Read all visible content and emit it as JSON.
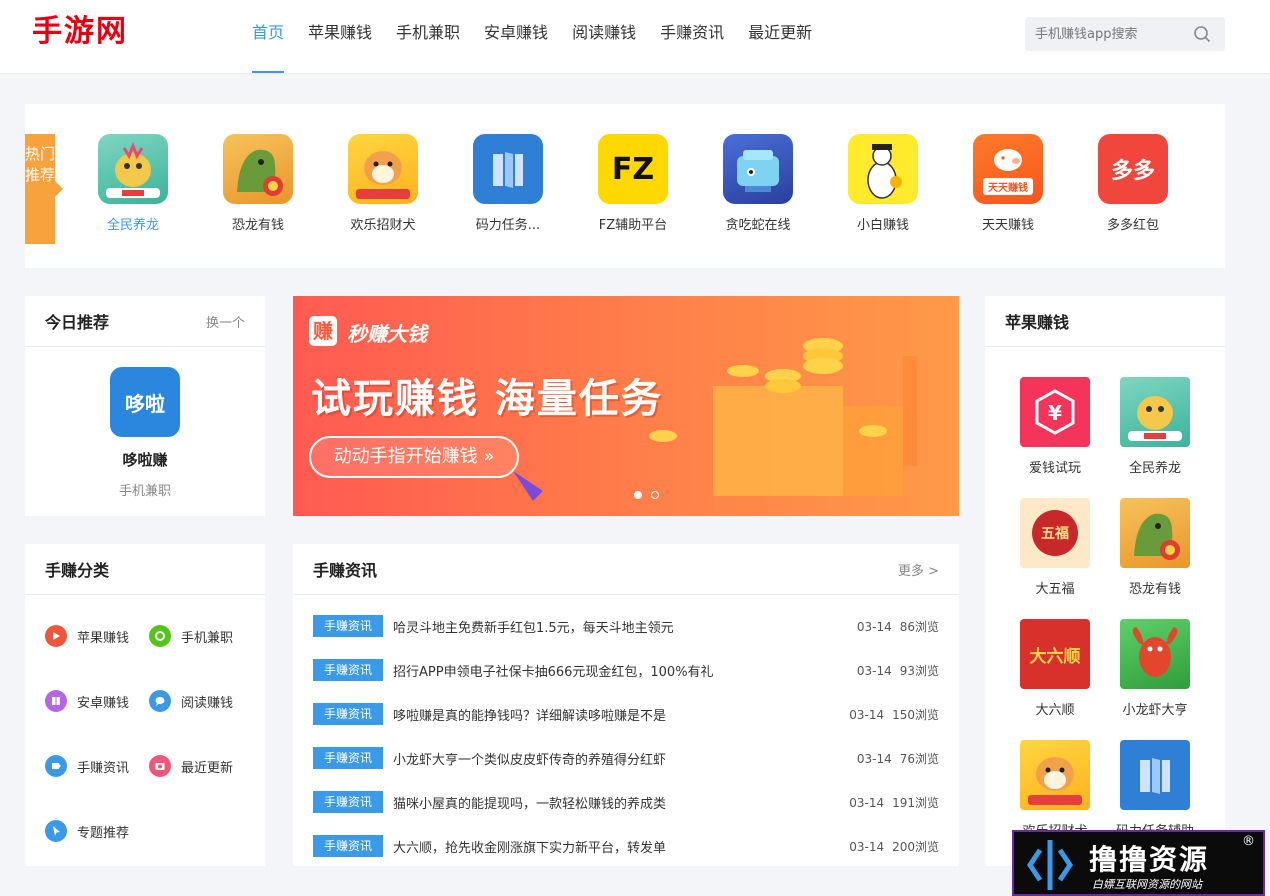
{
  "header": {
    "logo": "手游网",
    "nav": [
      "首页",
      "苹果赚钱",
      "手机兼职",
      "安卓赚钱",
      "阅读赚钱",
      "手赚资讯",
      "最近更新"
    ],
    "search_placeholder": "手机赚钱app搜索"
  },
  "hot": {
    "tag": "热门推荐",
    "items": [
      {
        "name": "全民养龙",
        "icon": "dragon-icon"
      },
      {
        "name": "恐龙有钱",
        "icon": "dinosaur-icon"
      },
      {
        "name": "欢乐招财犬",
        "icon": "dog-icon"
      },
      {
        "name": "码力任务...",
        "icon": "book-icon"
      },
      {
        "name": "FZ辅助平台",
        "icon": "fz-icon",
        "icon_text": "FZ"
      },
      {
        "name": "贪吃蛇在线",
        "icon": "snake-game-icon"
      },
      {
        "name": "小白赚钱",
        "icon": "goose-icon"
      },
      {
        "name": "天天赚钱",
        "icon": "piggy-bank-icon",
        "icon_text": "天天赚钱"
      },
      {
        "name": "多多红包",
        "icon": "red-packet-icon",
        "icon_text": "多多"
      }
    ]
  },
  "today": {
    "title": "今日推荐",
    "more": "换一个",
    "app_icon_text": "哆啦",
    "app_name": "哆啦赚",
    "app_category": "手机兼职"
  },
  "banner": {
    "brand_char": "赚",
    "brand": "秒赚大钱",
    "headline": "试玩赚钱 海量任务",
    "cta": "动动手指开始赚钱 »"
  },
  "categories": {
    "title": "手赚分类",
    "items": [
      {
        "label": "苹果赚钱",
        "color": "#f0563c",
        "icon": "play-icon"
      },
      {
        "label": "手机兼职",
        "color": "#52c41a",
        "icon": "gear-icon"
      },
      {
        "label": "安卓赚钱",
        "color": "#b466e8",
        "icon": "book-icon"
      },
      {
        "label": "阅读赚钱",
        "color": "#3a9ae8",
        "icon": "chat-icon"
      },
      {
        "label": "手赚资讯",
        "color": "#3a9ae8",
        "icon": "tag-icon"
      },
      {
        "label": "最近更新",
        "color": "#f0567a",
        "icon": "camera-icon"
      },
      {
        "label": "专题推荐",
        "color": "#3a9ae8",
        "icon": "cursor-icon"
      }
    ]
  },
  "news": {
    "title": "手赚资讯",
    "more": "更多 >",
    "rows": [
      {
        "tag": "手赚资讯",
        "title": "哈灵斗地主免费新手红包1.5元，每天斗地主领元",
        "date": "03-14",
        "views": "86浏览"
      },
      {
        "tag": "手赚资讯",
        "title": "招行APP申领电子社保卡抽666元现金红包，100%有礼",
        "date": "03-14",
        "views": "93浏览"
      },
      {
        "tag": "手赚资讯",
        "title": "哆啦赚是真的能挣钱吗？详细解读哆啦赚是不是",
        "date": "03-14",
        "views": "150浏览"
      },
      {
        "tag": "手赚资讯",
        "title": "小龙虾大亨一个类似皮皮虾传奇的养殖得分红虾",
        "date": "03-14",
        "views": "76浏览"
      },
      {
        "tag": "手赚资讯",
        "title": "猫咪小屋真的能提现吗，一款轻松赚钱的养成类",
        "date": "03-14",
        "views": "191浏览"
      },
      {
        "tag": "手赚资讯",
        "title": "大六顺，抢先收金刚涨旗下实力新平台，转发单",
        "date": "03-14",
        "views": "200浏览"
      }
    ]
  },
  "apple": {
    "title": "苹果赚钱",
    "items": [
      {
        "name": "爱钱试玩",
        "icon": "yen-hexagon-icon"
      },
      {
        "name": "全民养龙",
        "icon": "dragon-icon"
      },
      {
        "name": "大五福",
        "icon": "wufu-icon",
        "icon_text": "五福"
      },
      {
        "name": "恐龙有钱",
        "icon": "dinosaur-icon"
      },
      {
        "name": "大六顺",
        "icon": "liushun-icon",
        "icon_text": "大六顺"
      },
      {
        "name": "小龙虾大亨",
        "icon": "crayfish-icon"
      },
      {
        "name": "欢乐招财犬",
        "icon": "dog-icon"
      },
      {
        "name": "码力任务辅助",
        "icon": "book-icon"
      }
    ]
  },
  "watermark": {
    "main": "撸撸资源",
    "sub": "白嫖互联网资源的网站",
    "reg": "®"
  }
}
